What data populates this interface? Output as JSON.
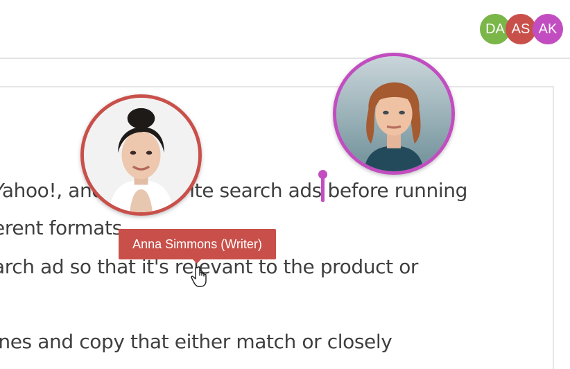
{
  "presence": {
    "users": [
      {
        "initials": "DA",
        "color": "#7ab648"
      },
      {
        "initials": "AS",
        "color": "#c9504a"
      },
      {
        "initials": "AK",
        "color": "#c24dc0"
      }
    ]
  },
  "document": {
    "lines": [
      {
        "text": "Yahoo!, and Bing. Write search ads before running"
      },
      {
        "text": "erent formats."
      },
      {
        "text": "arch ad so that it's relevant to the product or"
      },
      {
        "text": "ines and copy that either match or closely"
      }
    ]
  },
  "tooltip": {
    "text": "Anna Simmons (Writer)",
    "color": "#c9504a"
  },
  "caret": {
    "color": "#c24dc0"
  },
  "avatars": [
    {
      "name": "avatar-icon",
      "ring_color": "#c9504a"
    },
    {
      "name": "avatar-icon",
      "ring_color": "#c24dc0"
    }
  ]
}
